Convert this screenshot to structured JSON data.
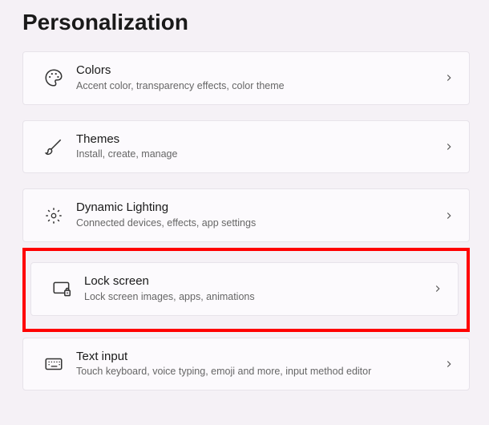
{
  "pageTitle": "Personalization",
  "items": [
    {
      "title": "Colors",
      "subtitle": "Accent color, transparency effects, color theme"
    },
    {
      "title": "Themes",
      "subtitle": "Install, create, manage"
    },
    {
      "title": "Dynamic Lighting",
      "subtitle": "Connected devices, effects, app settings"
    },
    {
      "title": "Lock screen",
      "subtitle": "Lock screen images, apps, animations"
    },
    {
      "title": "Text input",
      "subtitle": "Touch keyboard, voice typing, emoji and more, input method editor"
    }
  ]
}
